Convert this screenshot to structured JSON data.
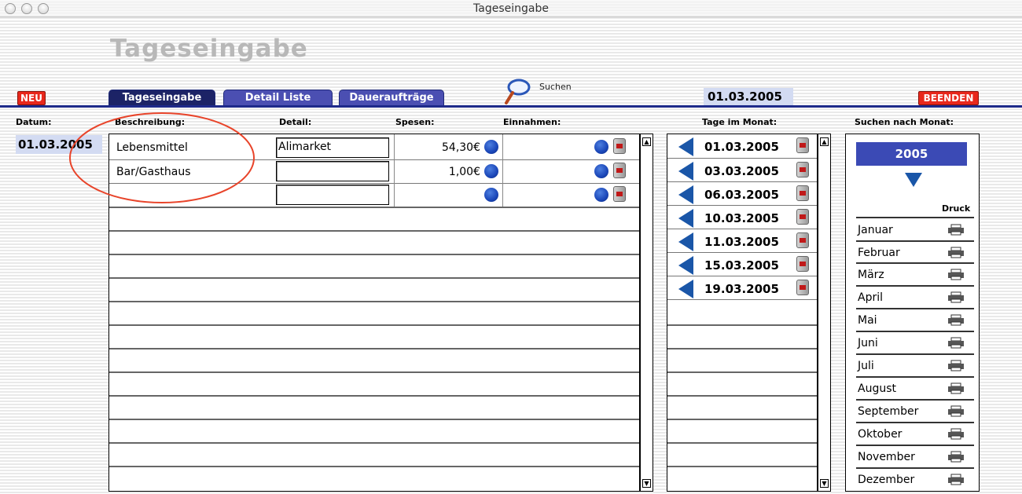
{
  "window": {
    "title": "Tageseingabe"
  },
  "header": {
    "big_title": "Tageseingabe"
  },
  "toolbar": {
    "new_label": "NEU",
    "exit_label": "BEENDEN",
    "tabs": [
      {
        "label": "Tageseingabe",
        "active": true
      },
      {
        "label": "Detail Liste",
        "active": false
      },
      {
        "label": "Daueraufträge",
        "active": false
      }
    ],
    "search_label": "Suchen",
    "current_date": "01.03.2005"
  },
  "columns": {
    "datum": "Datum:",
    "beschreibung": "Beschreibung:",
    "detail": "Detail:",
    "spesen": "Spesen:",
    "einnahmen": "Einnahmen:",
    "tage": "Tage im Monat:",
    "suchen_monat": "Suchen nach Monat:"
  },
  "datum_value": "01.03.2005",
  "entries": [
    {
      "beschreibung": "Lebensmittel",
      "detail": "Alimarket",
      "spesen": "54,30€",
      "einnahmen": ""
    },
    {
      "beschreibung": "Bar/Gasthaus",
      "detail": "",
      "spesen": "1,00€",
      "einnahmen": ""
    },
    {
      "beschreibung": "",
      "detail": "",
      "spesen": "",
      "einnahmen": ""
    }
  ],
  "dates": [
    "01.03.2005",
    "03.03.2005",
    "06.03.2005",
    "10.03.2005",
    "11.03.2005",
    "15.03.2005",
    "19.03.2005"
  ],
  "month_panel": {
    "year": "2005",
    "druck_label": "Druck",
    "months": [
      "Januar",
      "Februar",
      "März",
      "April",
      "Mai",
      "Juni",
      "Juli",
      "August",
      "September",
      "Oktober",
      "November",
      "Dezember"
    ]
  },
  "icons": {
    "new": "plus-icon",
    "search": "magnifier-icon",
    "delete": "trash-icon",
    "goto": "triangle-left-icon",
    "print": "printer-icon",
    "select": "blue-dot-icon"
  },
  "colors": {
    "accent": "#1e2a8a",
    "danger": "#e8281c",
    "highlight": "#d3dbf2",
    "annotation": "#e8442a"
  }
}
